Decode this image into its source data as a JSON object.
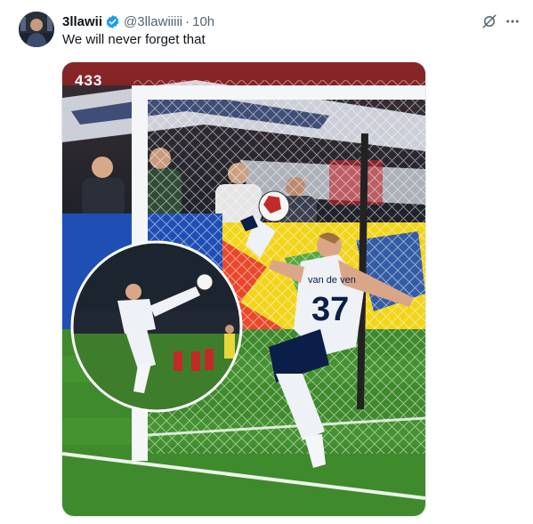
{
  "tweet": {
    "display_name": "3llawii",
    "handle": "@3llawiiiii",
    "separator": "·",
    "time": "10h",
    "text": "We will never forget that",
    "verified": true,
    "icons": [
      "verified-badge-icon",
      "grok-icon",
      "more-icon"
    ]
  },
  "media": {
    "watermark": "433",
    "player_name_on_shirt": "van de ven",
    "player_number": "37",
    "colors": {
      "pitch": "#3f8a2c",
      "ad_board_blue": "#1f4fb5",
      "ad_board_yellow": "#f2d51a",
      "kit": "#eef1f6"
    }
  },
  "colors": {
    "text_primary": "#0f1419",
    "text_secondary": "#536471",
    "verified_blue": "#1d9bf0"
  }
}
